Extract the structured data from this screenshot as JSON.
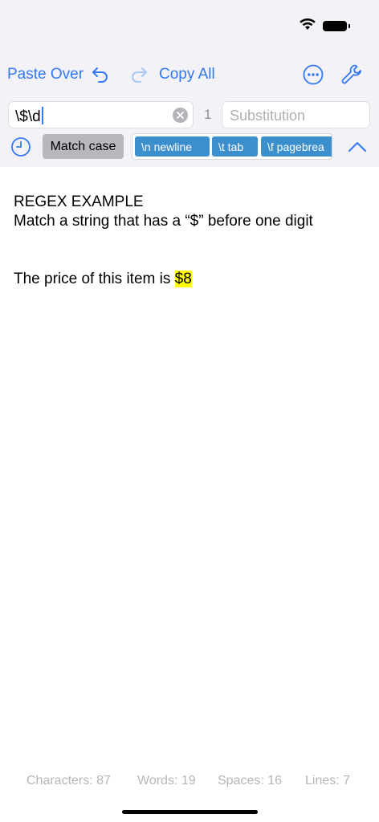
{
  "toolbar": {
    "paste_over_label": "Paste Over",
    "copy_all_label": "Copy All",
    "icons": [
      "undo-icon",
      "redo-icon",
      "more-icon",
      "wrench-icon"
    ],
    "accent_color": "#3478f6"
  },
  "search": {
    "value": "\\$\\d",
    "match_count": "1",
    "substitution_placeholder": "Substitution"
  },
  "options": {
    "match_case_label": "Match case",
    "chips": [
      "\\n newline",
      "\\t tab",
      "\\f pagebrea"
    ],
    "chip_color": "#3c8fcd"
  },
  "document": {
    "line1": "REGEX EXAMPLE",
    "line2": "Match a string that has a “$” before one digit",
    "line3_before": "The price of this item is ",
    "line3_match": "$8",
    "highlight_color": "#ffff00"
  },
  "stats": {
    "characters": "Characters: 87",
    "words": "Words: 19",
    "spaces": "Spaces: 16",
    "lines": "Lines: 7"
  }
}
